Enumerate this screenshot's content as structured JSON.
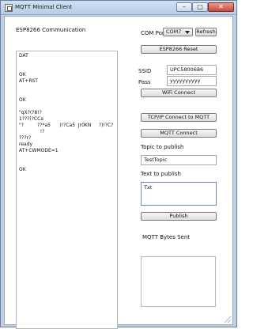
{
  "window": {
    "title": "MQTT Minimal Client",
    "controls": {
      "minimize": "–",
      "maximize": "□",
      "close": "✕"
    }
  },
  "left_panel": {
    "label": "ESP8266 Communication",
    "log_text": "DAT\n\n\nOK\nAT+RST\n\n\nOK\n\n\"qX?(?8!?\n1???(?CCa\n\"?         ??*a5      )!?Ca5  Jr0KN     ?)!?C?\n              !?\n???r?\nready\nAT+CWMODE=1\n\n\nOK"
  },
  "right_panel": {
    "com_port_label": "COM Port",
    "com_port_value": "COM7",
    "refresh_label": "Refresh",
    "esp_reset_label": "ESP8266 Reset",
    "ssid_label": "SSID",
    "ssid_value": "UPC5800686",
    "pass_label": "Pass",
    "pass_value": "yyyyyyyyyy",
    "wifi_connect_label": "WiFi Connect",
    "tcpip_connect_label": "TCP/IP Connect to MQTT",
    "mqtt_connect_label": "MQTT Connect",
    "topic_label": "Topic to publish",
    "topic_value": "TestTopic",
    "text_label": "Text to publish",
    "text_value": "Txt",
    "publish_label": "Publish",
    "bytes_label": "MQTT Bytes Sent"
  }
}
